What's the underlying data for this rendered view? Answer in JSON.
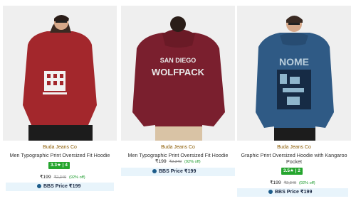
{
  "products": [
    {
      "brand": "Buda Jeans Co",
      "title": "Men Typographic Print Oversized Fit Hoodie",
      "rating": "3.3★ | 4",
      "price": "₹199",
      "mrp": "₹2,349",
      "discount": "(92% off)",
      "bbs_label": "BBS Price ₹199",
      "colors": {
        "garment": "#a3272c",
        "background": "#efefef"
      }
    },
    {
      "brand": "Buda Jeans Co",
      "title": "Men Typographic Print Oversized Fit Hoodie",
      "rating": "",
      "price": "₹199",
      "mrp": "₹2,349",
      "discount": "(92% off)",
      "bbs_label": "BBS Price ₹199",
      "back_print": [
        "SAN DIEGO",
        "WOLFPACK"
      ],
      "colors": {
        "garment": "#7a1f2e",
        "background": "#efefef"
      }
    },
    {
      "brand": "Buda Jeans Co",
      "title": "Graphic Print Oversized Hoodie with Kangaroo Pocket",
      "rating": "3.5★ | 2",
      "price": "₹199",
      "mrp": "₹2,349",
      "discount": "(92% off)",
      "bbs_label": "BBS Price ₹199",
      "back_print": [
        "NOME"
      ],
      "colors": {
        "garment": "#2f5a85",
        "background": "#efefef"
      }
    }
  ],
  "icons": {
    "bbs": "bbs-circle-icon"
  },
  "accent_colors": {
    "rating_badge": "#25a52e",
    "bbs_bar": "#e8f4fb",
    "brand_text": "#8a5a00"
  }
}
